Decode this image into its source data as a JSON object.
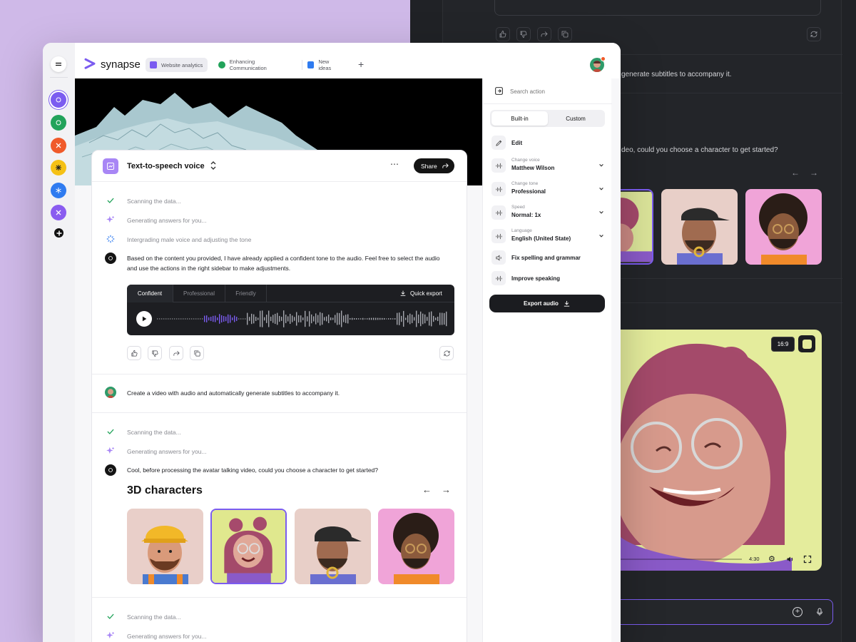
{
  "app": {
    "brand": "synapse",
    "tabs": [
      {
        "label": "Website analytics",
        "active": true,
        "color": "#7b5cf0"
      },
      {
        "label": "Enhancing Communication",
        "active": false,
        "color": "#22a35a"
      },
      {
        "label": "New ideas",
        "active": false,
        "color": "#2f7bf0"
      }
    ]
  },
  "header": {
    "title": "Text-to-speech voice",
    "share_label": "Share"
  },
  "chat": {
    "block1": {
      "steps": [
        "Scanning the data...",
        "Generating answers for you...",
        "Intergrading male voice and adjusting the tone"
      ],
      "answer_line1": "Based on the content you provided, I have already applied a confident tone to the audio. Feel free to select the audio",
      "answer_line2": "and use the actions in the right sidebar to make adjustments."
    },
    "player": {
      "tabs": [
        "Confident",
        "Professional",
        "Friendly"
      ],
      "quick_export": "Quick export"
    },
    "user_msg": "Create a video with audio and automatically generate subtitles to accompany it.",
    "block2": {
      "steps": [
        "Scanning the data...",
        "Generating answers for you..."
      ],
      "answer": "Cool, before processing the avatar talking video, could you choose a character to get started?"
    },
    "characters_title": "3D characters",
    "block3": {
      "steps": [
        "Scanning the data...",
        "Generating answers for you..."
      ]
    }
  },
  "sidebar": {
    "search_placeholder": "Search action",
    "segments": [
      "Built-in",
      "Custom"
    ],
    "edit": "Edit",
    "voice": {
      "caption": "Change voice",
      "value": "Matthew Wilson"
    },
    "tone": {
      "caption": "Change tone",
      "value": "Professional"
    },
    "speed": {
      "caption": "Speed",
      "value": "Normal: 1x"
    },
    "language": {
      "caption": "Language",
      "value": "English (United State)"
    },
    "fix": "Fix spelling and grammar",
    "improve": "Improve speaking",
    "export": "Export audio"
  },
  "dark": {
    "msg1": "generate subtitles to accompany it.",
    "msg2": "deo, could you choose a character to get started?",
    "ratio": "16:9",
    "time": "4:30"
  },
  "colors": {
    "accent": "#7b5cf0",
    "dark": "#1d1e22",
    "selected_border": "#7b5cf0"
  }
}
